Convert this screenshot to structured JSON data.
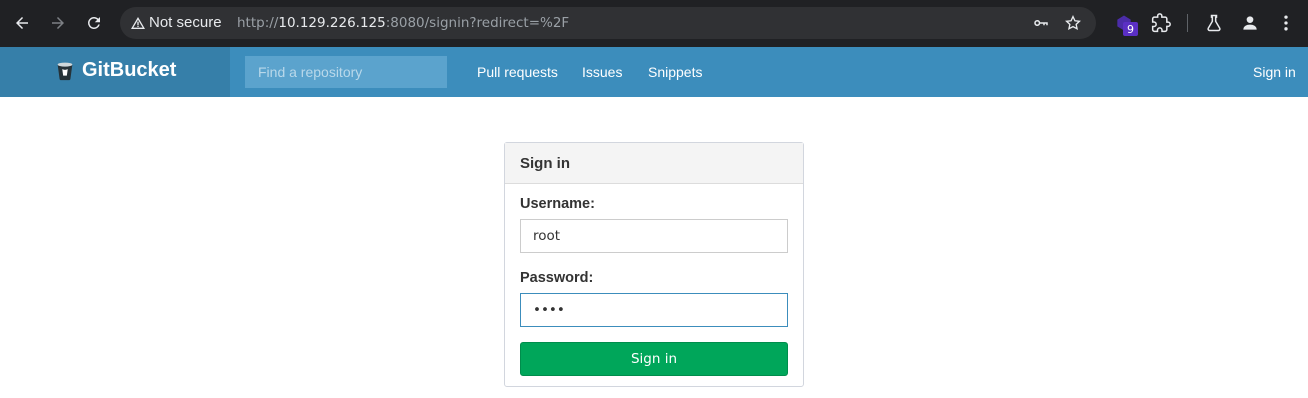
{
  "browser": {
    "security_label": "Not secure",
    "url_scheme": "http://",
    "url_host": "10.129.226.125",
    "url_rest": ":8080/signin?redirect=%2F",
    "extension_badge": "9",
    "icons": [
      "back-icon",
      "forward-icon",
      "reload-icon",
      "warning-icon",
      "key-icon",
      "star-icon",
      "extension-icon",
      "puzzle-icon",
      "flask-icon",
      "profile-icon",
      "menu-icon"
    ]
  },
  "header": {
    "logo_text": "GitBucket",
    "search_placeholder": "Find a repository",
    "nav": [
      "Pull requests",
      "Issues",
      "Snippets"
    ],
    "signin_link": "Sign in",
    "colors": {
      "bar": "#3c8dbc",
      "logo_bg": "#367fa9"
    }
  },
  "signin": {
    "title": "Sign in",
    "username_label": "Username:",
    "username_value": "root",
    "password_label": "Password:",
    "password_value": "rose",
    "submit_label": "Sign in",
    "colors": {
      "submit": "#00a65a"
    }
  }
}
